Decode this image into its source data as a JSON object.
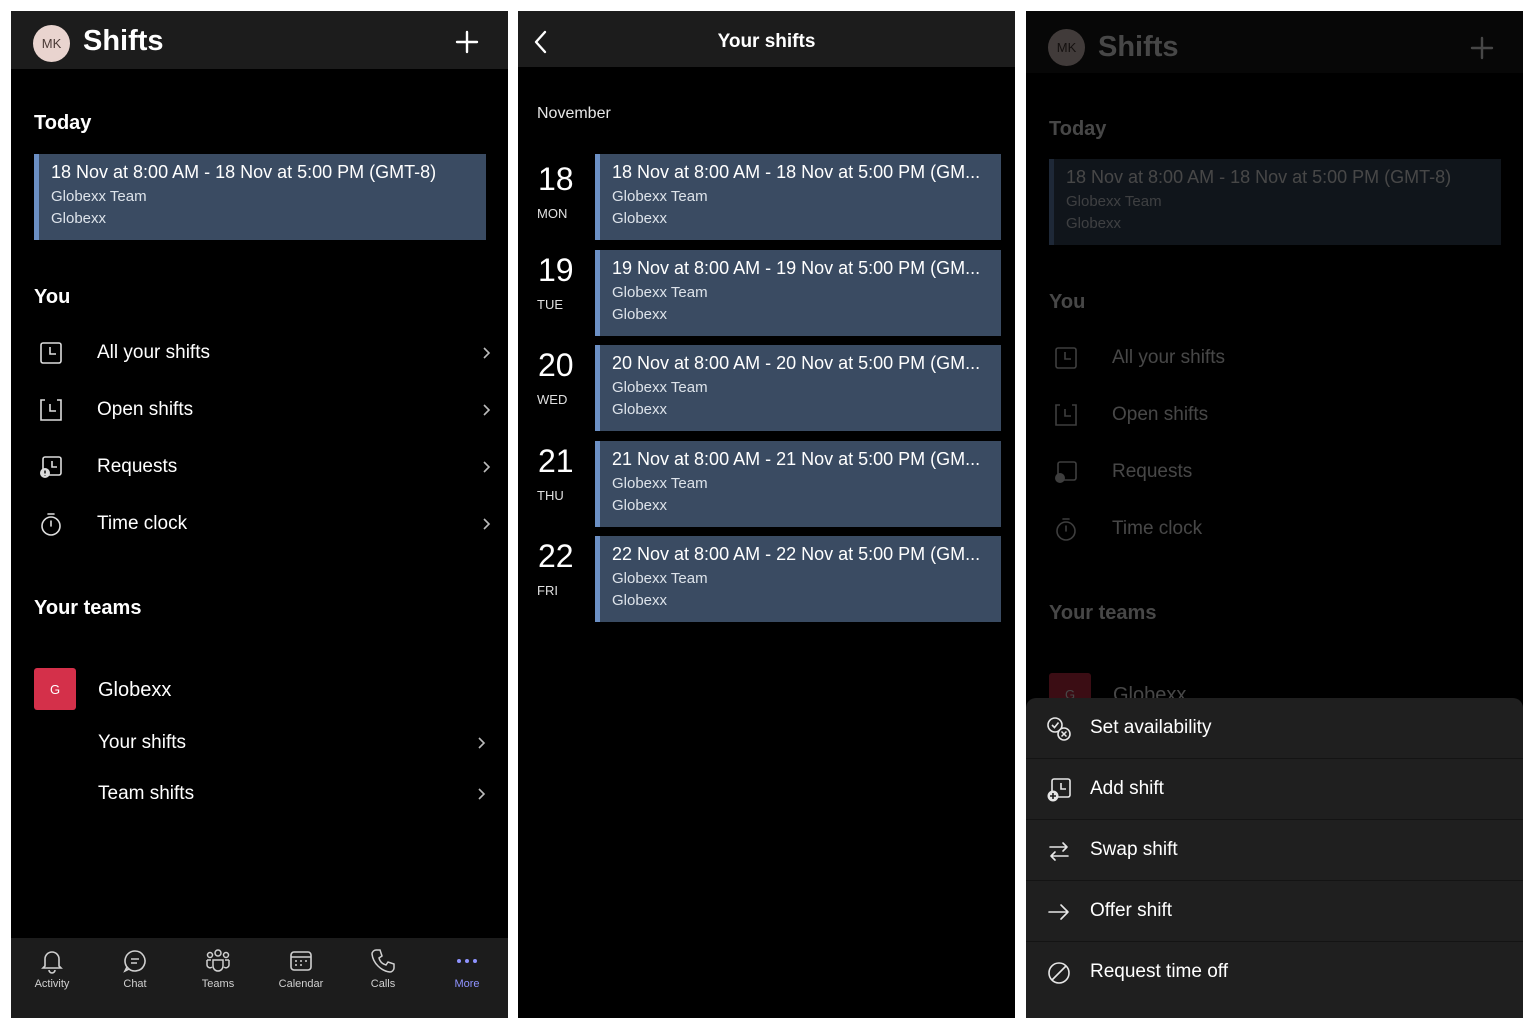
{
  "home": {
    "avatar_initials": "MK",
    "app_title": "Shifts",
    "today_heading": "Today",
    "today_shift": {
      "when": "18 Nov at 8:00 AM - 18 Nov at 5:00 PM (GMT-8)",
      "team": "Globexx Team",
      "org": "Globexx"
    },
    "you_heading": "You",
    "you_items": [
      {
        "label": "All your shifts",
        "icon": "clock-icon"
      },
      {
        "label": "Open shifts",
        "icon": "open-shift-icon"
      },
      {
        "label": "Requests",
        "icon": "request-icon"
      },
      {
        "label": "Time clock",
        "icon": "stopwatch-icon"
      }
    ],
    "teams_heading": "Your teams",
    "team": {
      "badge": "G",
      "name": "Globexx",
      "items": [
        "Your shifts",
        "Team shifts"
      ],
      "badge_color": "#d4304a"
    }
  },
  "tabs": [
    {
      "label": "Activity",
      "icon": "bell-icon"
    },
    {
      "label": "Chat",
      "icon": "chat-icon"
    },
    {
      "label": "Teams",
      "icon": "teams-icon"
    },
    {
      "label": "Calendar",
      "icon": "calendar-icon"
    },
    {
      "label": "Calls",
      "icon": "phone-icon"
    },
    {
      "label": "More",
      "icon": "more-icon",
      "active": true
    }
  ],
  "your_shifts": {
    "title": "Your shifts",
    "month": "November",
    "days": [
      {
        "num": "18",
        "name": "MON",
        "when": "18 Nov at 8:00 AM - 18 Nov at 5:00 PM (GM...",
        "team": "Globexx Team",
        "org": "Globexx"
      },
      {
        "num": "19",
        "name": "TUE",
        "when": "19 Nov at 8:00 AM - 19 Nov at 5:00 PM (GM...",
        "team": "Globexx Team",
        "org": "Globexx"
      },
      {
        "num": "20",
        "name": "WED",
        "when": "20 Nov at 8:00 AM - 20 Nov at 5:00 PM (GM...",
        "team": "Globexx Team",
        "org": "Globexx"
      },
      {
        "num": "21",
        "name": "THU",
        "when": "21 Nov at 8:00 AM - 21 Nov at 5:00 PM (GM...",
        "team": "Globexx Team",
        "org": "Globexx"
      },
      {
        "num": "22",
        "name": "FRI",
        "when": "22 Nov at 8:00 AM - 22 Nov at 5:00 PM (GM...",
        "team": "Globexx Team",
        "org": "Globexx"
      }
    ]
  },
  "sheet": {
    "items": [
      {
        "label": "Set availability",
        "icon": "availability-icon"
      },
      {
        "label": "Add shift",
        "icon": "add-shift-icon"
      },
      {
        "label": "Swap shift",
        "icon": "swap-icon"
      },
      {
        "label": "Offer shift",
        "icon": "arrow-right-icon"
      },
      {
        "label": "Request time off",
        "icon": "prohibit-icon"
      }
    ]
  },
  "colors": {
    "shift_card": "#3a4b62",
    "shift_accent": "#6b8fc4",
    "active_tab": "#8f93ff"
  }
}
